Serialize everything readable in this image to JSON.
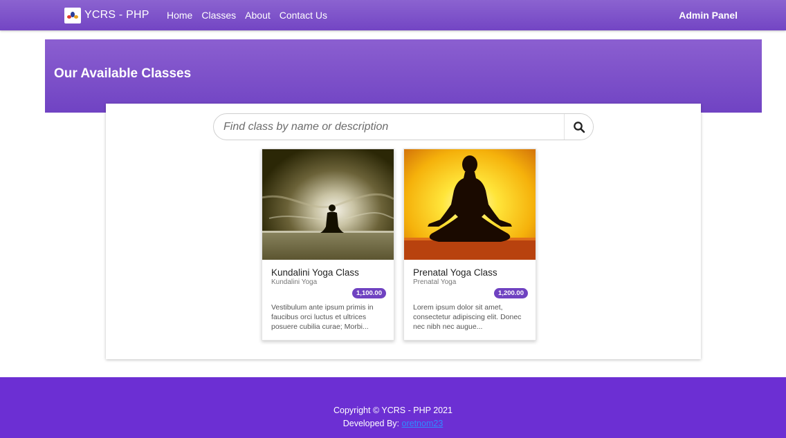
{
  "navbar": {
    "brand": "YCRS - PHP",
    "links": [
      "Home",
      "Classes",
      "About",
      "Contact Us"
    ],
    "admin": "Admin Panel"
  },
  "banner": {
    "title": "Our Available Classes"
  },
  "search": {
    "placeholder": "Find class by name or description",
    "value": ""
  },
  "classes": [
    {
      "title": "Kundalini Yoga Class",
      "category": "Kundalini Yoga",
      "price": "1,100.00",
      "description": "Vestibulum ante ipsum primis in faucibus orci luctus et ultrices posuere cubilia curae; Morbi..."
    },
    {
      "title": "Prenatal Yoga Class",
      "category": "Prenatal Yoga",
      "price": "1,200.00",
      "description": "Lorem ipsum dolor sit amet, consectetur adipiscing elit. Donec nec nibh nec augue..."
    }
  ],
  "footer": {
    "copyright": "Copyright © YCRS - PHP 2021",
    "developed_label": "Developed By:",
    "developer": "oretnom23"
  },
  "colors": {
    "accent": "#7345c4",
    "footer": "#6c2fd3",
    "price_badge": "#6f42c1",
    "link": "#2f8bff"
  },
  "icons": [
    "logo-icon",
    "search-icon"
  ]
}
